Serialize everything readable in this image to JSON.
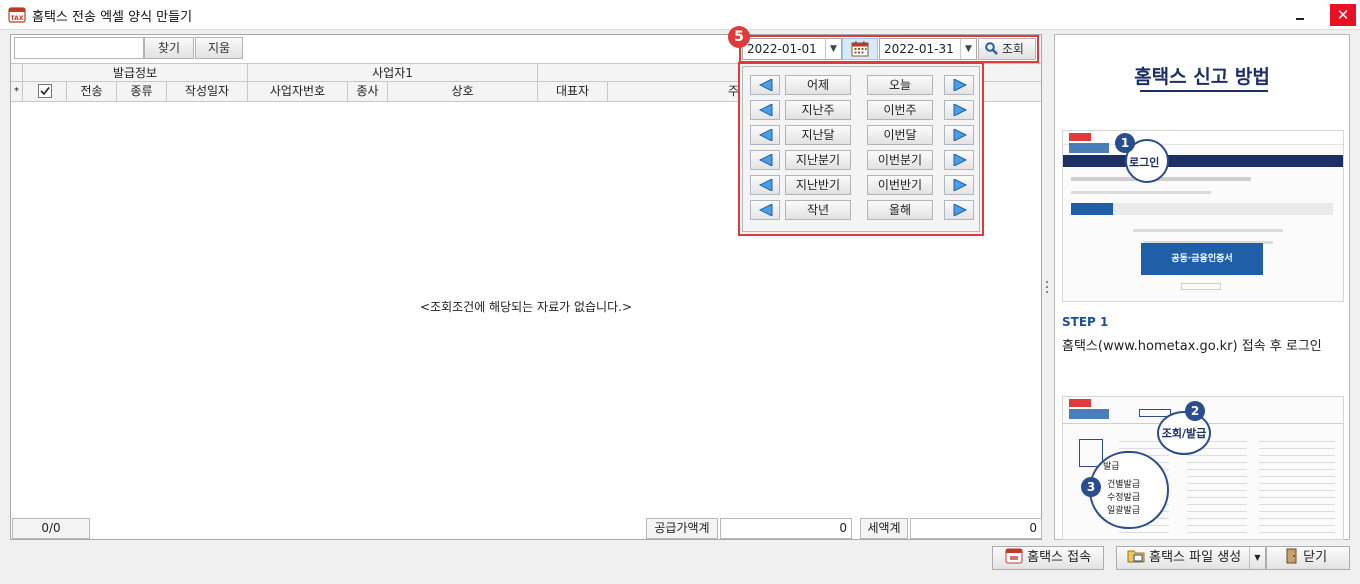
{
  "window": {
    "title": "홈택스 전송 엑셀 양식 만들기",
    "app_icon_text": "TAX"
  },
  "toolbar": {
    "search_value": "",
    "find_label": "찾기",
    "clear_label": "지움"
  },
  "grid": {
    "group_headers": {
      "issue": "발급정보",
      "business": "사업자1"
    },
    "columns": {
      "sel": "*",
      "send": "전송",
      "kind": "종류",
      "date": "작성일자",
      "biz_no": "사업자번호",
      "branch": "종사",
      "name": "상호",
      "ceo": "대표자",
      "addr": "주"
    },
    "empty_message": "<조회조건에 해당되는 자료가 없습니다.>"
  },
  "footer": {
    "count": "0/0",
    "supply_label": "공급가액계",
    "supply_value": "0",
    "tax_label": "세액계",
    "tax_value": "0"
  },
  "date_filter": {
    "badge": "5",
    "from": "2022-01-01",
    "to": "2022-01-31",
    "query_label": "조회"
  },
  "presets": [
    {
      "left": "어제",
      "right": "오늘"
    },
    {
      "left": "지난주",
      "right": "이번주"
    },
    {
      "left": "지난달",
      "right": "이번달"
    },
    {
      "left": "지난분기",
      "right": "이번분기"
    },
    {
      "left": "지난반기",
      "right": "이번반기"
    },
    {
      "left": "작년",
      "right": "올해"
    }
  ],
  "help": {
    "title": "홈택스 신고 방법",
    "step1_label": "STEP 1",
    "step1_desc": "홈택스(www.hometax.go.kr) 접속 후 로그인",
    "shot1": {
      "badge": "1",
      "callout": "로그인",
      "button": "공동·금융인증서"
    },
    "shot2": {
      "badge2": "2",
      "callout2": "조회/발급",
      "badge3": "3",
      "menu_title": "발급",
      "menu_items": [
        "건별발급",
        "수정발급",
        "일괄발급"
      ]
    }
  },
  "bottom": {
    "hometax_label": "홈택스 접속",
    "make_file_label": "홈택스 파일 생성",
    "close_label": "닫기"
  },
  "colors": {
    "highlight": "#e03b3b",
    "accent_blue": "#1f5fa8",
    "navy": "#1c2f66"
  }
}
